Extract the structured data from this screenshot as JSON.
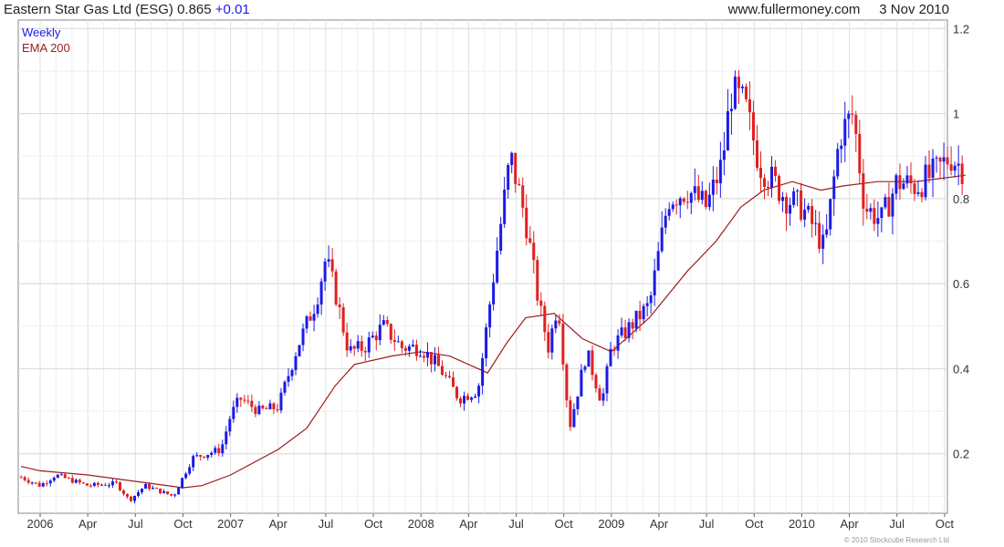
{
  "header": {
    "title": "Eastern Star Gas Ltd (ESG)",
    "price": "0.865",
    "change": "+0.01",
    "site": "www.fullermoney.com",
    "date": "3 Nov 2010"
  },
  "copyright": "© 2010 Stockcube Research Ltd",
  "chart_data": {
    "type": "candlestick",
    "title": "Eastern Star Gas Ltd (ESG) 0.865 +0.01",
    "legend": [
      {
        "name": "Weekly",
        "color": "#1a1ae6"
      },
      {
        "name": "EMA 200",
        "color": "#9b1c1c"
      }
    ],
    "legend_position": "top-left",
    "y_axis_side": "right",
    "ylim": [
      0.06,
      1.22
    ],
    "yticks": [
      0.2,
      0.4,
      0.6,
      0.8,
      1,
      1.2
    ],
    "xlim": [
      2006.0,
      2010.88
    ],
    "xticks": [
      {
        "x": 2006.0,
        "label": "2006"
      },
      {
        "x": 2006.25,
        "label": "Apr"
      },
      {
        "x": 2006.5,
        "label": "Jul"
      },
      {
        "x": 2006.75,
        "label": "Oct"
      },
      {
        "x": 2007.0,
        "label": "2007"
      },
      {
        "x": 2007.25,
        "label": "Apr"
      },
      {
        "x": 2007.5,
        "label": "Jul"
      },
      {
        "x": 2007.75,
        "label": "Oct"
      },
      {
        "x": 2008.0,
        "label": "2008"
      },
      {
        "x": 2008.25,
        "label": "Apr"
      },
      {
        "x": 2008.5,
        "label": "Jul"
      },
      {
        "x": 2008.75,
        "label": "Oct"
      },
      {
        "x": 2009.0,
        "label": "2009"
      },
      {
        "x": 2009.25,
        "label": "Apr"
      },
      {
        "x": 2009.5,
        "label": "Jul"
      },
      {
        "x": 2009.75,
        "label": "Oct"
      },
      {
        "x": 2010.0,
        "label": "2010"
      },
      {
        "x": 2010.25,
        "label": "Apr"
      },
      {
        "x": 2010.5,
        "label": "Jul"
      },
      {
        "x": 2010.75,
        "label": "Oct"
      }
    ],
    "grid": true,
    "colors": {
      "up": "#1a1ae6",
      "down": "#e02020",
      "ema": "#9b1c1c",
      "grid": "#d8d8d8"
    },
    "price_path": [
      [
        2005.9,
        0.145
      ],
      [
        2006.0,
        0.125
      ],
      [
        2006.08,
        0.15
      ],
      [
        2006.25,
        0.125
      ],
      [
        2006.4,
        0.13
      ],
      [
        2006.47,
        0.09
      ],
      [
        2006.55,
        0.125
      ],
      [
        2006.7,
        0.1
      ],
      [
        2006.8,
        0.19
      ],
      [
        2006.95,
        0.21
      ],
      [
        2007.0,
        0.29
      ],
      [
        2007.05,
        0.33
      ],
      [
        2007.15,
        0.3
      ],
      [
        2007.25,
        0.31
      ],
      [
        2007.35,
        0.45
      ],
      [
        2007.45,
        0.56
      ],
      [
        2007.5,
        0.66
      ],
      [
        2007.55,
        0.58
      ],
      [
        2007.62,
        0.44
      ],
      [
        2007.7,
        0.45
      ],
      [
        2007.8,
        0.5
      ],
      [
        2007.9,
        0.45
      ],
      [
        2008.0,
        0.45
      ],
      [
        2008.1,
        0.4
      ],
      [
        2008.2,
        0.33
      ],
      [
        2008.3,
        0.35
      ],
      [
        2008.4,
        0.68
      ],
      [
        2008.47,
        0.9
      ],
      [
        2008.55,
        0.75
      ],
      [
        2008.62,
        0.55
      ],
      [
        2008.67,
        0.45
      ],
      [
        2008.72,
        0.56
      ],
      [
        2008.78,
        0.26
      ],
      [
        2008.87,
        0.44
      ],
      [
        2008.95,
        0.32
      ],
      [
        2009.0,
        0.45
      ],
      [
        2009.1,
        0.5
      ],
      [
        2009.2,
        0.55
      ],
      [
        2009.3,
        0.8
      ],
      [
        2009.4,
        0.82
      ],
      [
        2009.5,
        0.78
      ],
      [
        2009.58,
        0.88
      ],
      [
        2009.63,
        1.05
      ],
      [
        2009.7,
        1.02
      ],
      [
        2009.78,
        0.88
      ],
      [
        2009.85,
        0.84
      ],
      [
        2009.92,
        0.8
      ],
      [
        2010.0,
        0.78
      ],
      [
        2010.08,
        0.72
      ],
      [
        2010.12,
        0.68
      ],
      [
        2010.2,
        0.95
      ],
      [
        2010.27,
        1.0
      ],
      [
        2010.33,
        0.78
      ],
      [
        2010.42,
        0.75
      ],
      [
        2010.5,
        0.84
      ],
      [
        2010.6,
        0.83
      ],
      [
        2010.7,
        0.86
      ],
      [
        2010.78,
        0.9
      ],
      [
        2010.86,
        0.865
      ]
    ],
    "ema_path": [
      [
        2005.9,
        0.17
      ],
      [
        2006.0,
        0.16
      ],
      [
        2006.25,
        0.15
      ],
      [
        2006.5,
        0.135
      ],
      [
        2006.75,
        0.12
      ],
      [
        2006.85,
        0.125
      ],
      [
        2007.0,
        0.15
      ],
      [
        2007.25,
        0.21
      ],
      [
        2007.4,
        0.26
      ],
      [
        2007.55,
        0.36
      ],
      [
        2007.65,
        0.41
      ],
      [
        2007.85,
        0.43
      ],
      [
        2008.0,
        0.44
      ],
      [
        2008.15,
        0.43
      ],
      [
        2008.35,
        0.39
      ],
      [
        2008.45,
        0.46
      ],
      [
        2008.55,
        0.52
      ],
      [
        2008.7,
        0.53
      ],
      [
        2008.85,
        0.47
      ],
      [
        2009.0,
        0.44
      ],
      [
        2009.2,
        0.52
      ],
      [
        2009.4,
        0.63
      ],
      [
        2009.55,
        0.7
      ],
      [
        2009.68,
        0.78
      ],
      [
        2009.8,
        0.82
      ],
      [
        2009.95,
        0.84
      ],
      [
        2010.1,
        0.82
      ],
      [
        2010.22,
        0.83
      ],
      [
        2010.4,
        0.84
      ],
      [
        2010.6,
        0.84
      ],
      [
        2010.86,
        0.855
      ]
    ]
  }
}
